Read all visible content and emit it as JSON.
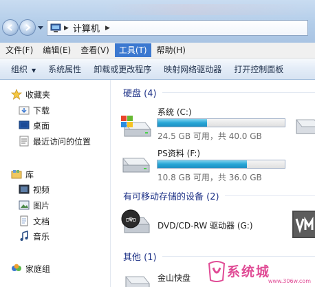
{
  "address": {
    "path": "计算机"
  },
  "menu": [
    {
      "label": "文件(F)",
      "active": false
    },
    {
      "label": "编辑(E)",
      "active": false
    },
    {
      "label": "查看(V)",
      "active": false
    },
    {
      "label": "工具(T)",
      "active": true
    },
    {
      "label": "帮助(H)",
      "active": false
    }
  ],
  "toolbar": {
    "organize": "组织",
    "system_props": "系统属性",
    "uninstall": "卸载或更改程序",
    "map_drive": "映射网络驱动器",
    "control_panel": "打开控制面板"
  },
  "nav": {
    "favorites": "收藏夹",
    "downloads": "下载",
    "desktop": "桌面",
    "recent": "最近访问的位置",
    "libraries": "库",
    "videos": "视频",
    "pictures": "图片",
    "documents": "文档",
    "music": "音乐",
    "homegroup": "家庭组"
  },
  "groups": {
    "hard_disks": "硬盘 (4)",
    "removable": "有可移动存储的设备 (2)",
    "other": "其他 (1)"
  },
  "drives": {
    "c": {
      "name": "系统 (C:)",
      "space": "24.5 GB 可用，共 40.0 GB",
      "used_fraction": 0.39
    },
    "f": {
      "name": "PS资料 (F:)",
      "space": "10.8 GB 可用，共 36.0 GB",
      "used_fraction": 0.7
    },
    "g": {
      "name": "DVD/CD-RW 驱动器 (G:)"
    },
    "other1": {
      "name": "金山快盘"
    }
  },
  "watermark": {
    "text": "系统城",
    "sub": "www.306w.com"
  },
  "colors": {
    "accent": "#3b78d0",
    "bar_fill": "#28a6d6",
    "group_header": "#1e3287"
  }
}
